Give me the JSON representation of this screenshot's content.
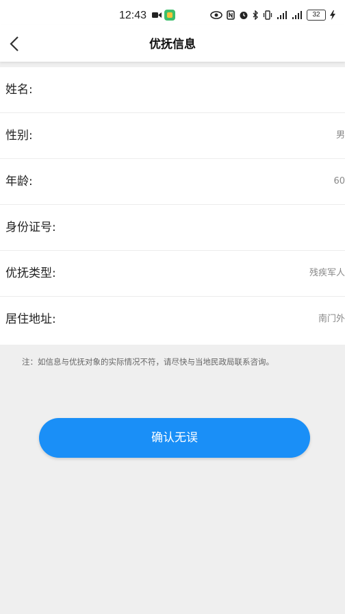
{
  "status_bar": {
    "time": "12:43",
    "battery": "32"
  },
  "header": {
    "title": "优抚信息"
  },
  "form": {
    "rows": [
      {
        "label": "姓名:",
        "value": ""
      },
      {
        "label": "性别:",
        "value": "男"
      },
      {
        "label": "年龄:",
        "value": "60"
      },
      {
        "label": "身份证号:",
        "value": ""
      },
      {
        "label": "优抚类型:",
        "value": "残疾军人"
      },
      {
        "label": "居住地址:",
        "value": "南门外"
      }
    ]
  },
  "note": "注：如信息与优抚对象的实际情况不符，请尽快与当地民政局联系咨询。",
  "confirm_button": {
    "label": "确认无误",
    "color": "#1a8ff7"
  }
}
